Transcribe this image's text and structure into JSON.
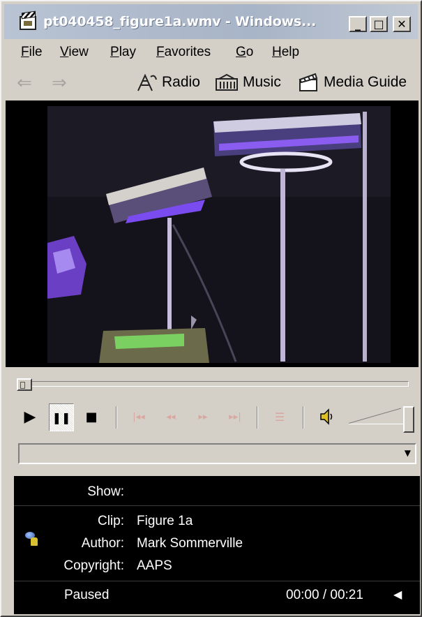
{
  "window": {
    "title": "pt040458_figure1a.wmv - Windows...",
    "minimize_label": "_",
    "maximize_label": "□",
    "close_label": "✕"
  },
  "menu": {
    "items": [
      "File",
      "View",
      "Play",
      "Favorites",
      "Go",
      "Help"
    ]
  },
  "toolbar": {
    "back_icon": "⇐",
    "forward_icon": "⇒",
    "radio_label": "Radio",
    "music_label": "Music",
    "media_guide_label": "Media Guide"
  },
  "controls": {
    "play_icon": "▶",
    "pause_icon": "❚❚",
    "stop_icon": "■",
    "skip_back_icon": "|◂◂",
    "rewind_icon": "◂◂",
    "fast_forward_icon": "▸▸",
    "skip_forward_icon": "▸▸|",
    "playlist_icon": "☰",
    "volume_icon": "🔈",
    "dropdown_arrow": "▼",
    "volume_level": 1.0,
    "seek_position": 0.0
  },
  "info": {
    "show_label": "Show:",
    "show_value": "",
    "clip_label": "Clip:",
    "clip_value": "Figure 1a",
    "author_label": "Author:",
    "author_value": "Mark Sommerville",
    "copyright_label": "Copyright:",
    "copyright_value": "AAPS",
    "status": "Paused",
    "time": "00:00 / 00:21",
    "speaker_icon": "◀"
  }
}
